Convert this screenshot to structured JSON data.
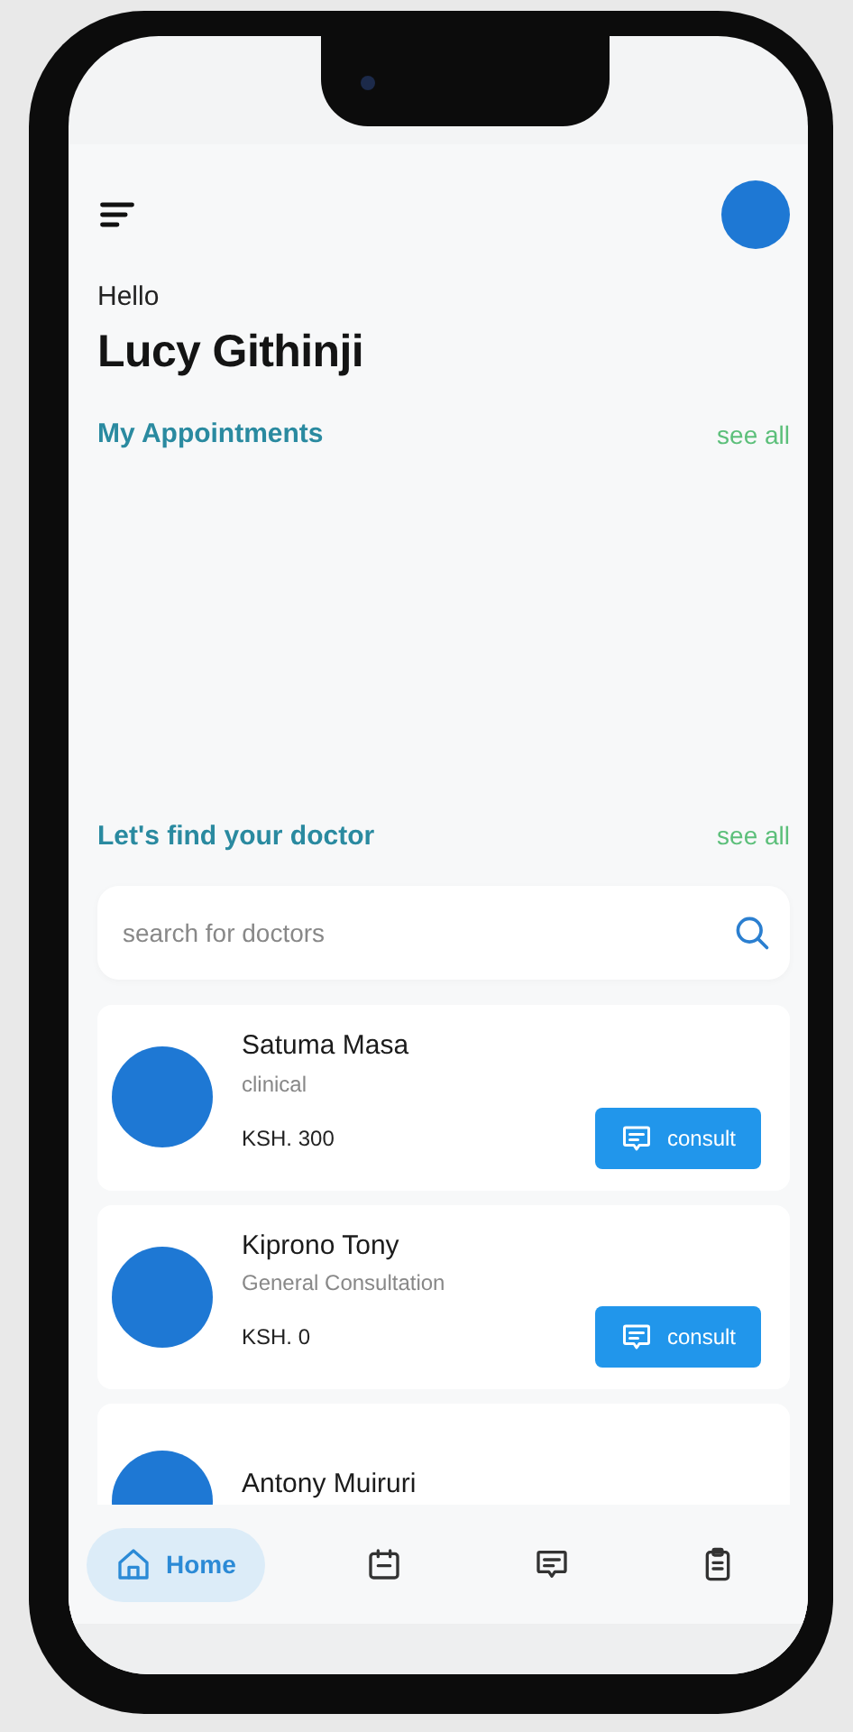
{
  "greeting": "Hello",
  "user_name": "Lucy Githinji",
  "appointments": {
    "title": "My Appointments",
    "link": "see all"
  },
  "doctors_section": {
    "title": "Let's find your doctor",
    "link": "see all"
  },
  "search": {
    "placeholder": "search for doctors"
  },
  "doctors": [
    {
      "name": "Satuma Masa",
      "specialty": "clinical",
      "price": "KSH. 300",
      "action": "consult"
    },
    {
      "name": "Kiprono Tony",
      "specialty": "General Consultation",
      "price": "KSH. 0",
      "action": "consult"
    },
    {
      "name": "Antony Muiruri"
    }
  ],
  "bottom_nav": [
    {
      "kind": "home",
      "label": "Home",
      "selected": true
    },
    {
      "kind": "calendar",
      "selected": false
    },
    {
      "kind": "chat",
      "selected": false
    },
    {
      "kind": "clipboard",
      "selected": false
    }
  ]
}
